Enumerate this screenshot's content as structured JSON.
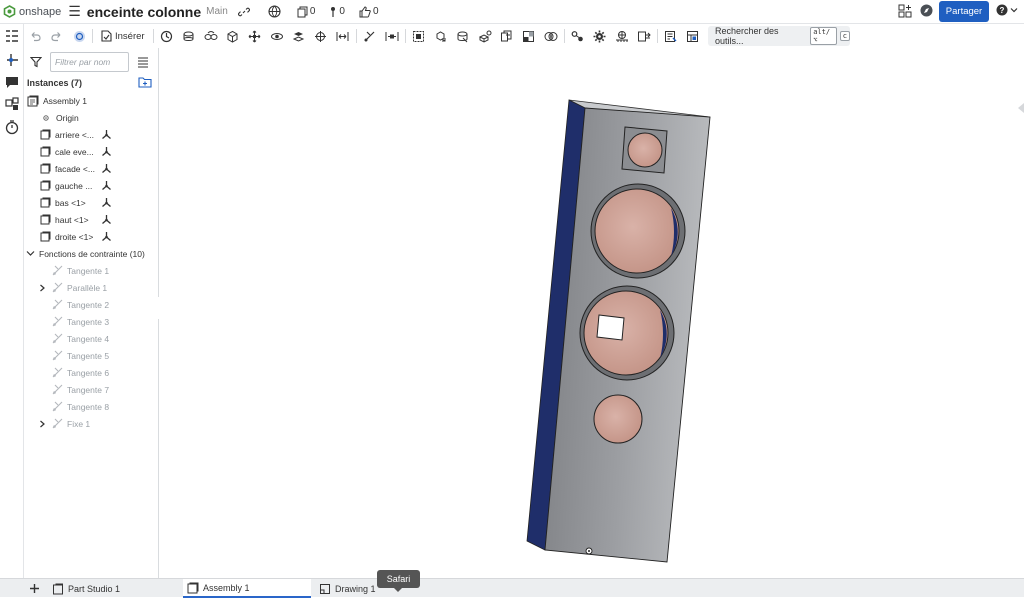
{
  "app": {
    "logo_text": "onshape"
  },
  "document": {
    "title": "enceinte colonne",
    "branch": "Main"
  },
  "top_counters": {
    "versions": "0",
    "comments": "0",
    "likes": "0"
  },
  "header": {
    "share_label": "Partager"
  },
  "toolbar": {
    "insert_label": "Insérer",
    "search_tools_label": "Rechercher des outils...",
    "search_shortcut_1": "alt/⌥",
    "search_shortcut_2": "c"
  },
  "instances_panel": {
    "filter_placeholder": "Filtrer par nom",
    "title": "Instances (7)",
    "root": "Assembly 1",
    "origin": "Origin",
    "parts": [
      "arriere <...",
      "cale eve...",
      "facade <...",
      "gauche ...",
      "bas <1>",
      "haut <1>",
      "droite <1>"
    ],
    "constraints_group": "Fonctions de contrainte (10)",
    "constraints": [
      "Tangente 1",
      "Parallèle 1",
      "Tangente 2",
      "Tangente 3",
      "Tangente 4",
      "Tangente 5",
      "Tangente 6",
      "Tangente 7",
      "Tangente 8",
      "Fixe 1"
    ]
  },
  "bottom_tabs": {
    "part_studio": "Part Studio 1",
    "assembly": "Assembly 1",
    "drawing": "Drawing 1"
  },
  "tooltip": "Safari",
  "colors": {
    "accent": "#1f5fc1",
    "body_gray": "#8e9094",
    "side_blue": "#1f2e6a",
    "driver_copper": "#cfa49a"
  }
}
